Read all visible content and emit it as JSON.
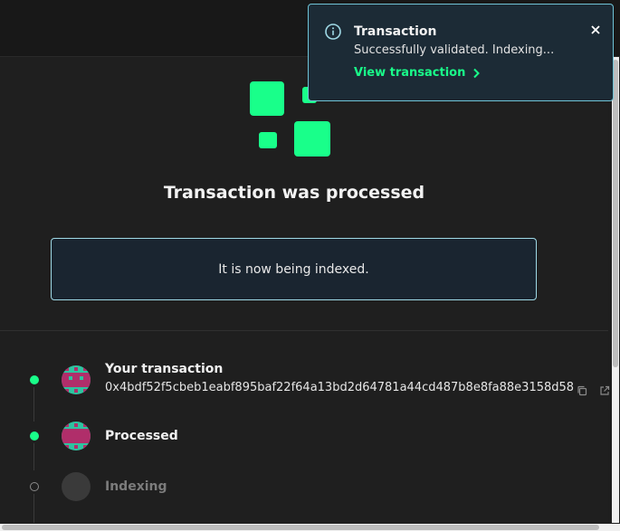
{
  "page": {
    "title": "Transaction was processed",
    "info_message": "It is now being indexed."
  },
  "steps": [
    {
      "title": "Your transaction",
      "status": "done",
      "hash": "0x4bdf52f5cbeb1eabf895baf22f64a13bd2d64781a44cd487b8e8fa88e3158d58"
    },
    {
      "title": "Processed",
      "status": "done"
    },
    {
      "title": "Indexing",
      "status": "pending"
    }
  ],
  "toast": {
    "title": "Transaction",
    "message": "Successfully validated. Indexing...",
    "link_label": "View transaction"
  },
  "colors": {
    "accent": "#19ff8a",
    "info_border": "#9fd9e6",
    "background": "#1e1e1e"
  }
}
